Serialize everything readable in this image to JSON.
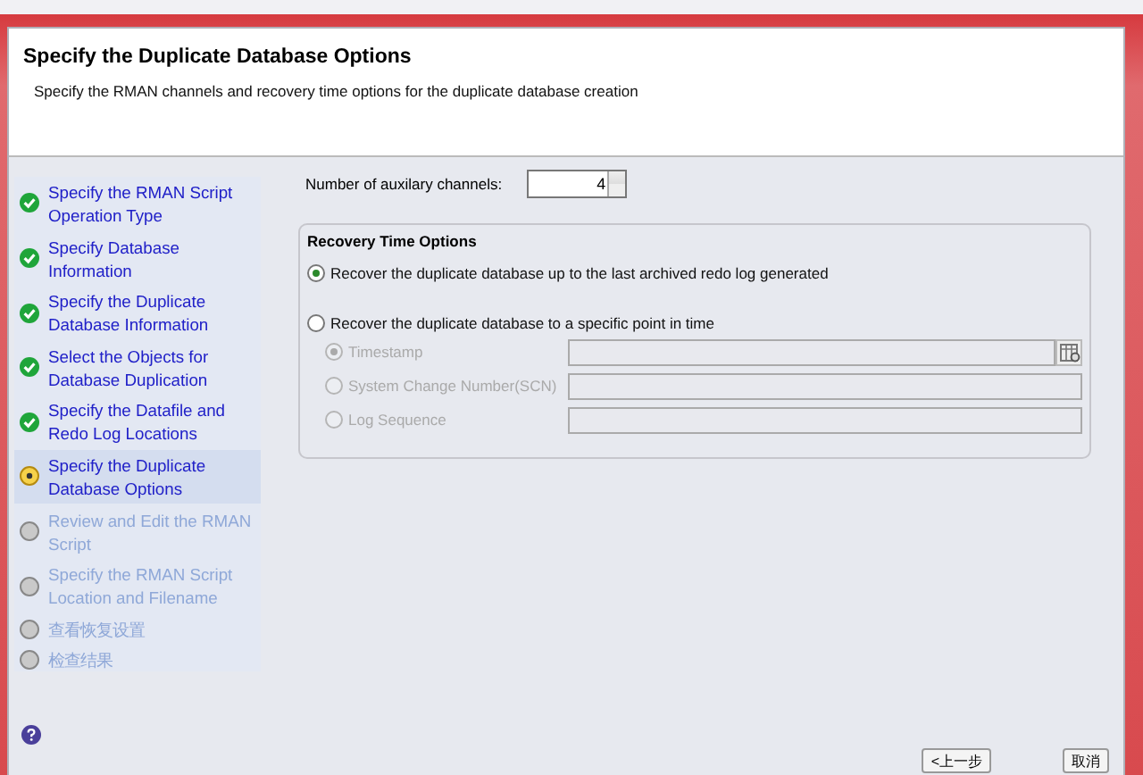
{
  "header": {
    "title": "Specify the Duplicate Database Options",
    "subtitle": "Specify the RMAN channels and recovery time options for the duplicate database creation"
  },
  "steps": [
    {
      "label": "Specify the RMAN Script Operation Type",
      "kind": "done",
      "selected": false
    },
    {
      "label": "Specify Database Information",
      "kind": "done",
      "selected": false
    },
    {
      "label": "Specify the Duplicate Database Information",
      "kind": "done",
      "selected": false
    },
    {
      "label": "Select the Objects for Database Duplication",
      "kind": "done",
      "selected": false
    },
    {
      "label": "Specify the Datafile and Redo Log Locations",
      "kind": "done",
      "selected": false
    },
    {
      "label": "Specify the Duplicate Database Options",
      "kind": "current",
      "selected": true
    },
    {
      "label": "Review and Edit the RMAN Script",
      "kind": "pending",
      "selected": false
    },
    {
      "label": "Specify the RMAN Script Location and Filename",
      "kind": "pending",
      "selected": false
    },
    {
      "label": "查看恢复设置",
      "kind": "pending",
      "selected": false
    },
    {
      "label": "检查结果",
      "kind": "pending",
      "selected": false
    }
  ],
  "channels": {
    "label": "Number of auxilary channels:",
    "value": "4"
  },
  "recovery": {
    "title": "Recovery Time Options",
    "options": [
      {
        "label": "Recover the duplicate database up to the last archived redo log generated",
        "selected": true
      },
      {
        "label": "Recover the duplicate database to a specific point in time",
        "selected": false
      }
    ],
    "point_options": [
      {
        "label": "Timestamp",
        "selected": true,
        "disabled": true,
        "calendar": true
      },
      {
        "label": "System Change Number(SCN)",
        "selected": false,
        "disabled": true,
        "calendar": false
      },
      {
        "label": "Log Sequence",
        "selected": false,
        "disabled": true,
        "calendar": false
      }
    ]
  },
  "buttons": [
    {
      "label": "<上一步"
    },
    {
      "label": "取消"
    }
  ]
}
